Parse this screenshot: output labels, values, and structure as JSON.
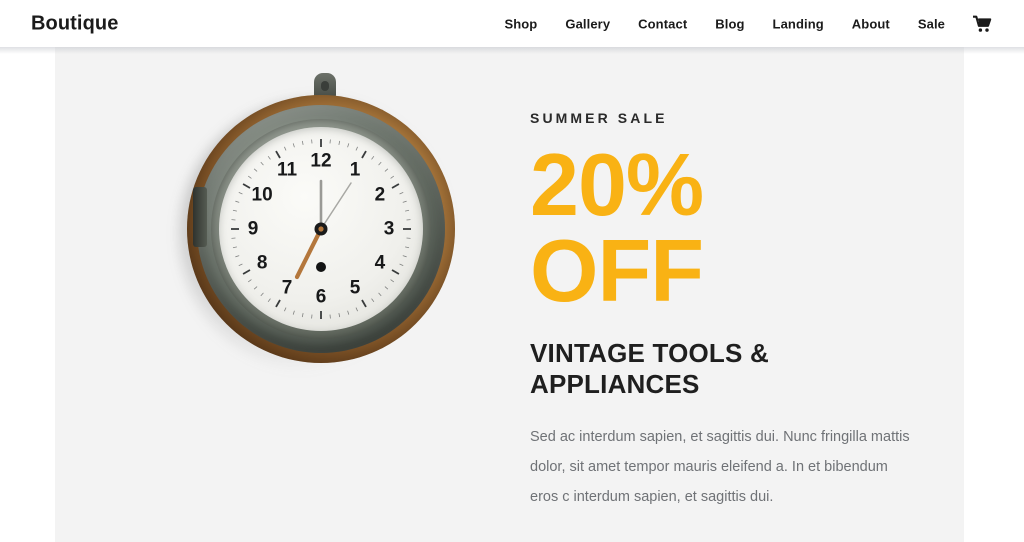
{
  "header": {
    "brand": "Boutique",
    "nav_items": [
      {
        "label": "Shop"
      },
      {
        "label": "Gallery"
      },
      {
        "label": "Contact"
      },
      {
        "label": "Blog"
      },
      {
        "label": "Landing"
      },
      {
        "label": "About"
      },
      {
        "label": "Sale"
      }
    ],
    "cart_icon": "shopping-cart-icon"
  },
  "hero": {
    "eyebrow": "SUMMER SALE",
    "discount_value": "20%",
    "discount_suffix": "OFF",
    "heading": "VINTAGE TOOLS & APPLIANCES",
    "paragraph": "Sed ac interdum sapien, et sagittis dui. Nunc fringilla mattis dolor, sit amet tempor mauris eleifend a. In et bibendum eros c interdum sapien, et sagittis dui.",
    "image": {
      "name": "vintage-ships-clock",
      "hour_numerals": [
        "12",
        "1",
        "2",
        "3",
        "4",
        "5",
        "6",
        "7",
        "8",
        "9",
        "10",
        "11"
      ],
      "time_shown": "7:00"
    }
  },
  "colors": {
    "accent": "#f9b214",
    "hero_background": "#f3f3f3",
    "page_background": "#ffffff",
    "heading_text": "#1f1f1f",
    "body_text": "#6f7276"
  }
}
